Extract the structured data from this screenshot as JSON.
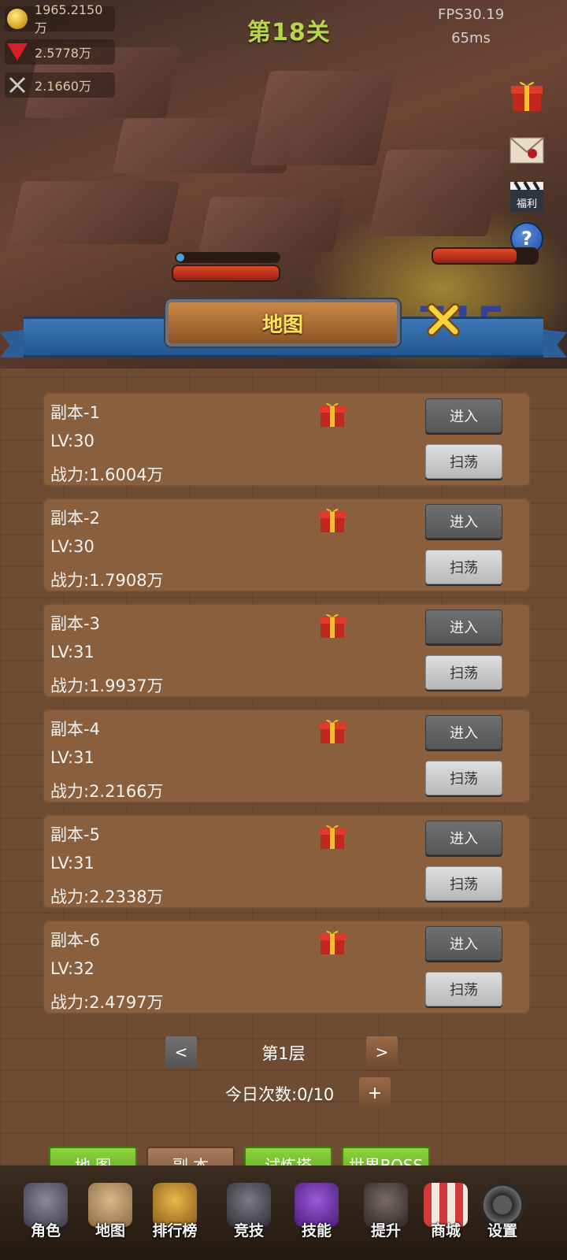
{
  "header": {
    "stage_label": "第18关",
    "fps": "FPS30.19",
    "latency": "65ms",
    "damage_number": "715"
  },
  "resources": [
    {
      "icon": "gold-coin-icon",
      "value": "1965.2150万"
    },
    {
      "icon": "red-gem-icon",
      "value": "2.5778万"
    },
    {
      "icon": "crossed-swords-icon",
      "value": "2.1660万"
    }
  ],
  "side_icons": [
    "gift-box-icon",
    "mail-icon",
    "welfare-clapperboard-icon",
    "help-icon"
  ],
  "side_icon_text": {
    "welfare": "福利",
    "help": "?"
  },
  "dialog": {
    "title": "地图",
    "close_icon": "close-x-icon"
  },
  "dungeons": [
    {
      "name": "副本-1",
      "level": "LV:30",
      "power": "战力:1.6004万",
      "enter": "进入",
      "sweep": "扫荡"
    },
    {
      "name": "副本-2",
      "level": "LV:30",
      "power": "战力:1.7908万",
      "enter": "进入",
      "sweep": "扫荡"
    },
    {
      "name": "副本-3",
      "level": "LV:31",
      "power": "战力:1.9937万",
      "enter": "进入",
      "sweep": "扫荡"
    },
    {
      "name": "副本-4",
      "level": "LV:31",
      "power": "战力:2.2166万",
      "enter": "进入",
      "sweep": "扫荡"
    },
    {
      "name": "副本-5",
      "level": "LV:31",
      "power": "战力:2.2338万",
      "enter": "进入",
      "sweep": "扫荡"
    },
    {
      "name": "副本-6",
      "level": "LV:32",
      "power": "战力:2.4797万",
      "enter": "进入",
      "sweep": "扫荡"
    }
  ],
  "pagination": {
    "prev": "<",
    "next": ">",
    "floor": "第1层",
    "daily_count": "今日次数:0/10",
    "add": "+"
  },
  "tabs": [
    {
      "label": "地 图",
      "active": true
    },
    {
      "label": "副 本",
      "active": false
    },
    {
      "label": "试炼塔",
      "active": true
    },
    {
      "label": "世界BOSS",
      "active": true
    }
  ],
  "bottom_nav": [
    {
      "label": "角色",
      "icon": "helmet-icon"
    },
    {
      "label": "地图",
      "icon": "map-pin-icon"
    },
    {
      "label": "排行榜",
      "icon": "trophy-icon"
    },
    {
      "label": "竞技",
      "icon": "crossed-swords-icon"
    },
    {
      "label": "技能",
      "icon": "spellbook-icon"
    },
    {
      "label": "提升",
      "icon": "armor-upgrade-icon"
    },
    {
      "label": "商城",
      "icon": "shop-stall-icon"
    },
    {
      "label": "设置",
      "icon": "settings-gear-icon"
    }
  ],
  "colors": {
    "stage_label": "#b7d64a",
    "dialog_title": "#ffe35a",
    "ribbon": "#2d5e97",
    "tab_active": "#7cc232",
    "tab_inactive": "#8a6042",
    "card_bg": "#8a5f3d"
  }
}
